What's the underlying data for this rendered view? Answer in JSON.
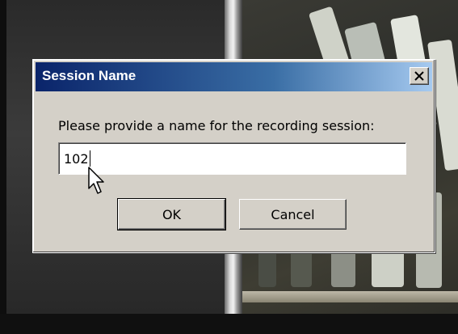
{
  "dialog": {
    "title": "Session Name",
    "close_symbol": "✕",
    "prompt": "Please provide a name for the recording session:",
    "session_name_value": "102",
    "ok_label": "OK",
    "cancel_label": "Cancel"
  },
  "icons": {
    "close": "close-icon",
    "cursor": "mouse-pointer-icon"
  },
  "colors": {
    "title_gradient_start": "#0a246a",
    "title_gradient_end": "#a6caf0",
    "dialog_face": "#d4d0c8"
  }
}
